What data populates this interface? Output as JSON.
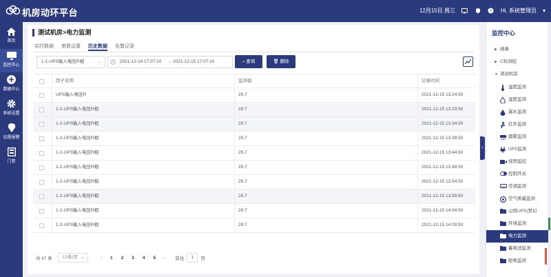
{
  "app": {
    "title": "机房动环平台"
  },
  "topbar": {
    "date": "12月15日 周三",
    "user": "Hi, 系统管理员"
  },
  "nav": [
    {
      "label": "首页",
      "icon": "home-icon"
    },
    {
      "label": "监控中心",
      "icon": "monitor-icon"
    },
    {
      "label": "数据中心",
      "icon": "data-icon"
    },
    {
      "label": "系统设置",
      "icon": "gear-icon"
    },
    {
      "label": "远程报警",
      "icon": "alarm-icon"
    },
    {
      "label": "门禁",
      "icon": "door-icon"
    }
  ],
  "breadcrumb": "测试机房>电力监测",
  "tabs": [
    "实时数据",
    "参数设置",
    "历史数据",
    "告警记录"
  ],
  "filters": {
    "select_value": "1-1-UPS输入电压R相",
    "date_start": "2021-12-14 17:07:10",
    "date_end": "2021-12-15 17:07:10",
    "search_label": "查询",
    "delete_label": "删除"
  },
  "table": {
    "headers": [
      "因子名称",
      "监测值",
      "记录时间"
    ],
    "rows": [
      {
        "name": "UPS输入电压R",
        "value": "29.7",
        "time": "2021-12-15 13:24:50"
      },
      {
        "name": "1-2-UPS输入电压R相",
        "value": "29.7",
        "time": "2021-12-15 13:29:50"
      },
      {
        "name": "1-2-UPS输入电压R相",
        "value": "29.7",
        "time": "2021-12-15 13:34:50"
      },
      {
        "name": "1-2-UPS输入电压R相",
        "value": "29.7",
        "time": "2021-12-15 13:39:50"
      },
      {
        "name": "1-2-UPS输入电压R相",
        "value": "29.7",
        "time": "2021-12-15 13:44:50"
      },
      {
        "name": "1-2-UPS输入电压R相",
        "value": "29.7",
        "time": "2021-12-15 13:49:50"
      },
      {
        "name": "1-2-UPS输入电压R相",
        "value": "29.7",
        "time": "2021-12-15 13:54:50"
      },
      {
        "name": "1-2-UPS输入电压R相",
        "value": "29.7",
        "time": "2021-12-15 13:59:50"
      },
      {
        "name": "1-2-UPS输入电压R相",
        "value": "29.7",
        "time": "2021-12-15 14:04:50"
      },
      {
        "name": "1-2-UPS输入电压R相",
        "value": "29.7",
        "time": "2021-12-15 14:09:50"
      }
    ]
  },
  "pagination": {
    "total": "共 47 条",
    "page_size": "10条/页",
    "pages": [
      "1",
      "2",
      "3",
      "4",
      "5"
    ],
    "current": "1",
    "goto_label": "前往",
    "goto_value": "1",
    "page_suffix": "页"
  },
  "right_panel": {
    "title": "监控中心",
    "groups": [
      {
        "label": "阀泰",
        "expanded": false
      },
      {
        "label": "C科测控",
        "expanded": false
      },
      {
        "label": "测试机房",
        "expanded": true
      }
    ],
    "items": [
      {
        "label": "温度监测",
        "icon": "thermometer-icon"
      },
      {
        "label": "湿度监测",
        "icon": "droplet-icon"
      },
      {
        "label": "漏水监测",
        "icon": "leak-icon"
      },
      {
        "label": "红外监测",
        "icon": "person-icon"
      },
      {
        "label": "烟雾监测",
        "icon": "smoke-icon"
      },
      {
        "label": "UPS监测",
        "icon": "plug-icon"
      },
      {
        "label": "视频监控",
        "icon": "camera-icon"
      },
      {
        "label": "控制开关",
        "icon": "switch-icon"
      },
      {
        "label": "空调监测",
        "icon": "aircon-icon"
      },
      {
        "label": "空气质量监测",
        "icon": "air-quality-icon"
      },
      {
        "label": "山特UPS(梦幻",
        "icon": "folder-icon"
      },
      {
        "label": "环境监测",
        "icon": "folder-icon"
      },
      {
        "label": "电力监测",
        "icon": "folder-icon",
        "active": true
      },
      {
        "label": "蓄电池监测",
        "icon": "folder-icon"
      },
      {
        "label": "配电监测",
        "icon": "folder-icon"
      }
    ]
  },
  "colors": {
    "primary": "#2b3a7d",
    "background": "#eef0f6",
    "row_alt": "#f3f5f9"
  }
}
